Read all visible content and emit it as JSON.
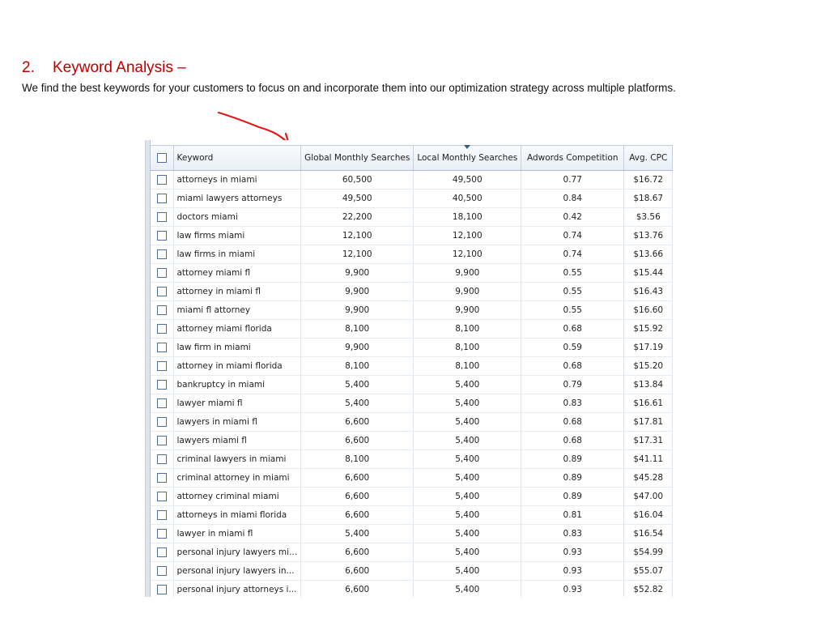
{
  "heading": {
    "number": "2.",
    "title": "Keyword Analysis –"
  },
  "subtitle": "We find the best keywords for your customers to focus on and incorporate them into our optimization strategy across multiple platforms.",
  "colors": {
    "heading": "#c00000",
    "arrow": "#e01a1a",
    "checkbox_border": "#4e6f99"
  },
  "table": {
    "columns": [
      "Keyword",
      "Global Monthly Searches",
      "Local Monthly Searches",
      "Adwords Competition",
      "Avg. CPC"
    ],
    "sorted_column": "Local Monthly Searches",
    "rows": [
      [
        "attorneys in miami",
        "60,500",
        "49,500",
        "0.77",
        "$16.72"
      ],
      [
        "miami lawyers attorneys",
        "49,500",
        "40,500",
        "0.84",
        "$18.67"
      ],
      [
        "doctors miami",
        "22,200",
        "18,100",
        "0.42",
        "$3.56"
      ],
      [
        "law firms miami",
        "12,100",
        "12,100",
        "0.74",
        "$13.76"
      ],
      [
        "law firms in miami",
        "12,100",
        "12,100",
        "0.74",
        "$13.66"
      ],
      [
        "attorney miami fl",
        "9,900",
        "9,900",
        "0.55",
        "$15.44"
      ],
      [
        "attorney in miami fl",
        "9,900",
        "9,900",
        "0.55",
        "$16.43"
      ],
      [
        "miami fl attorney",
        "9,900",
        "9,900",
        "0.55",
        "$16.60"
      ],
      [
        "attorney miami florida",
        "8,100",
        "8,100",
        "0.68",
        "$15.92"
      ],
      [
        "law firm in miami",
        "9,900",
        "8,100",
        "0.59",
        "$17.19"
      ],
      [
        "attorney in miami florida",
        "8,100",
        "8,100",
        "0.68",
        "$15.20"
      ],
      [
        "bankruptcy in miami",
        "5,400",
        "5,400",
        "0.79",
        "$13.84"
      ],
      [
        "lawyer miami fl",
        "5,400",
        "5,400",
        "0.83",
        "$16.61"
      ],
      [
        "lawyers in miami fl",
        "6,600",
        "5,400",
        "0.68",
        "$17.81"
      ],
      [
        "lawyers miami fl",
        "6,600",
        "5,400",
        "0.68",
        "$17.31"
      ],
      [
        "criminal lawyers in miami",
        "8,100",
        "5,400",
        "0.89",
        "$41.11"
      ],
      [
        "criminal attorney in miami",
        "6,600",
        "5,400",
        "0.89",
        "$45.28"
      ],
      [
        "attorney criminal miami",
        "6,600",
        "5,400",
        "0.89",
        "$47.00"
      ],
      [
        "attorneys in miami florida",
        "6,600",
        "5,400",
        "0.81",
        "$16.04"
      ],
      [
        "lawyer in miami fl",
        "5,400",
        "5,400",
        "0.83",
        "$16.54"
      ],
      [
        "personal injury lawyers mi...",
        "6,600",
        "5,400",
        "0.93",
        "$54.99"
      ],
      [
        "personal injury lawyers in...",
        "6,600",
        "5,400",
        "0.93",
        "$55.07"
      ],
      [
        "personal injury attorneys i...",
        "6,600",
        "5,400",
        "0.93",
        "$52.82"
      ]
    ]
  }
}
